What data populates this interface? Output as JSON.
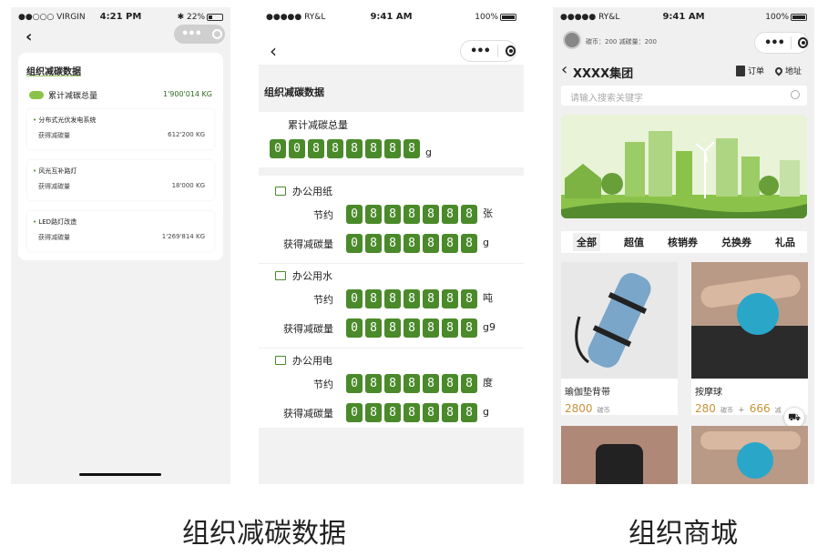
{
  "phone1": {
    "status": {
      "left": "●●○○○ VIRGIN",
      "time": "4:21 PM",
      "right": "✱ 22%"
    },
    "title": "组织减碳数据",
    "total_label": "累计减碳总量",
    "total_value": "1'900'014 KG",
    "items": [
      {
        "name": "分布式光伏发电系统",
        "label": "获得减碳量",
        "value": "612'200 KG"
      },
      {
        "name": "风光互补路灯",
        "label": "获得减碳量",
        "value": "18'000 KG"
      },
      {
        "name": "LED路灯改造",
        "label": "获得减碳量",
        "value": "1'269'814 KG"
      }
    ]
  },
  "phone2": {
    "status": {
      "left": "●●●●● RY&L",
      "time": "9:41 AM",
      "right": "100%"
    },
    "title": "组织减碳数据",
    "total_label": "累计减碳总量",
    "total_digits": [
      "0",
      "0",
      "8",
      "8",
      "8",
      "8",
      "8",
      "8"
    ],
    "total_unit": "g",
    "sections": [
      {
        "title": "办公用纸",
        "rows": [
          {
            "label": "节约",
            "digits": [
              "0",
              "8",
              "8",
              "8",
              "8",
              "8",
              "8"
            ],
            "unit": "张"
          },
          {
            "label": "获得减碳量",
            "digits": [
              "0",
              "8",
              "8",
              "8",
              "8",
              "8",
              "8"
            ],
            "unit": "g"
          }
        ]
      },
      {
        "title": "办公用水",
        "rows": [
          {
            "label": "节约",
            "digits": [
              "0",
              "8",
              "8",
              "8",
              "8",
              "8",
              "8"
            ],
            "unit": "吨"
          },
          {
            "label": "获得减碳量",
            "digits": [
              "0",
              "8",
              "8",
              "8",
              "8",
              "8",
              "8"
            ],
            "unit": "g9"
          }
        ]
      },
      {
        "title": "办公用电",
        "rows": [
          {
            "label": "节约",
            "digits": [
              "0",
              "8",
              "8",
              "8",
              "8",
              "8",
              "8"
            ],
            "unit": "度"
          },
          {
            "label": "获得减碳量",
            "digits": [
              "0",
              "8",
              "8",
              "8",
              "8",
              "8",
              "8"
            ],
            "unit": "g"
          }
        ]
      }
    ]
  },
  "phone3": {
    "status": {
      "left": "●●●●● RY&L",
      "time": "9:41 AM",
      "right": "100%"
    },
    "user_info": "碳币：200  减碳量：200",
    "title": "XXXX集团",
    "orders_label": "订单",
    "address_label": "地址",
    "search_placeholder": "请输入搜索关键字",
    "tabs": [
      "全部",
      "超值",
      "核销券",
      "兑换券",
      "礼品"
    ],
    "products": [
      {
        "name": "瑜伽垫背带",
        "price": "2800",
        "currency": "碳币"
      },
      {
        "name": "按摩球",
        "price": "280",
        "currency": "碳币",
        "plus": "+",
        "cash": "666",
        "cash_unit": "减"
      }
    ]
  },
  "captions": {
    "left": "组织减碳数据",
    "right": "组织商城"
  },
  "colors": {
    "green": "#4a8a2a",
    "dark_green": "#2d6a1e",
    "banner_green": "#9ccc65"
  }
}
